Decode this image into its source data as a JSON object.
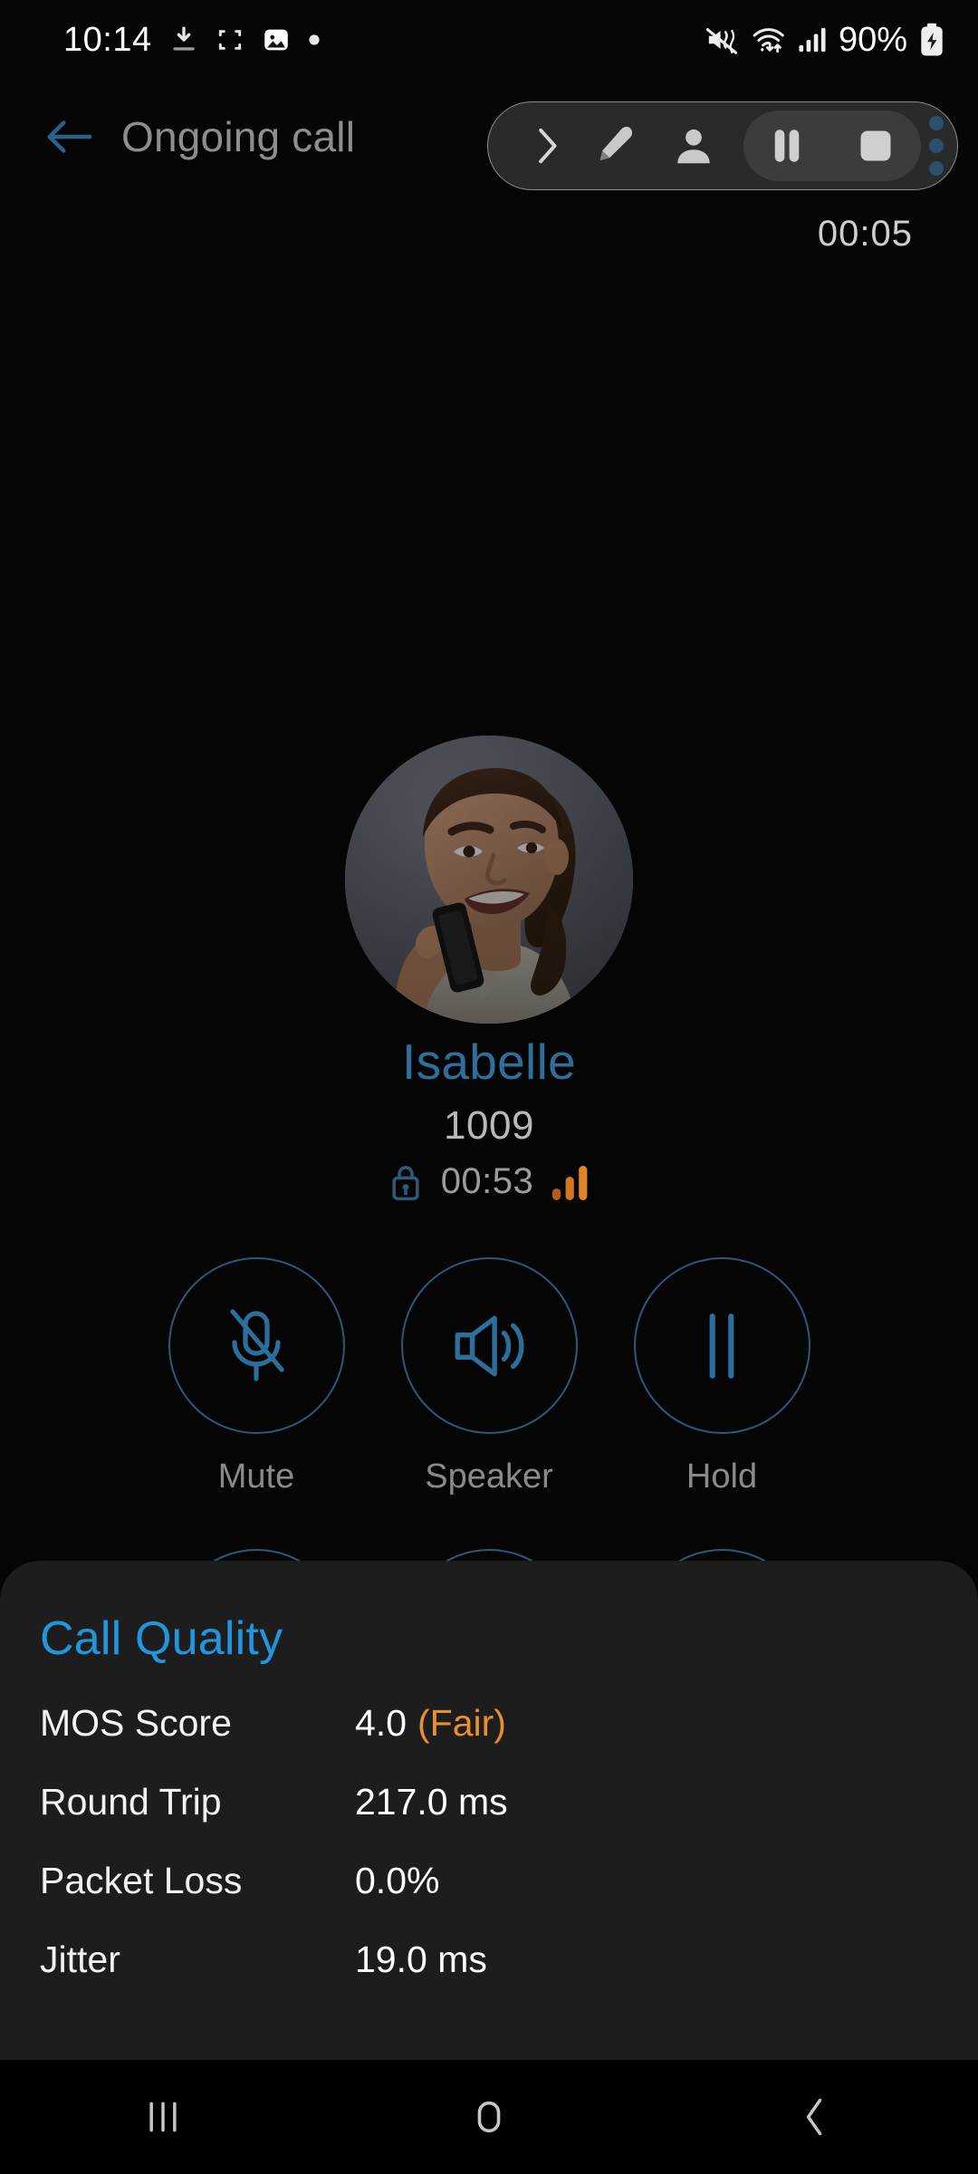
{
  "statusbar": {
    "time": "10:14",
    "battery_percent": "90%",
    "icons": [
      "download-icon",
      "screenshot-frame-icon",
      "image-icon",
      "dot-icon",
      "mute-vibrate-icon",
      "wifi-icon",
      "cellular-signal-icon",
      "battery-charging-icon"
    ]
  },
  "header": {
    "back_icon": "back-arrow-icon",
    "title": "Ongoing call"
  },
  "recorder": {
    "chevron_icon": "chevron-right-icon",
    "pen_icon": "pen-icon",
    "person_icon": "person-icon",
    "pause_icon": "pause-icon",
    "stop_icon": "stop-icon",
    "more_icon": "more-dots-icon",
    "timer": "00:05"
  },
  "call": {
    "avatar_name": "avatar",
    "contact_name": "Isabelle",
    "contact_number": "1009",
    "lock_icon": "lock-icon",
    "duration": "00:53",
    "signal_icon": "signal-bars-icon"
  },
  "controls": {
    "row1": [
      {
        "label": "Mute",
        "icon": "microphone-muted-icon"
      },
      {
        "label": "Speaker",
        "icon": "speaker-icon"
      },
      {
        "label": "Hold",
        "icon": "pause-icon"
      }
    ],
    "row2": [
      {
        "label": "",
        "icon": "hidden-control-icon"
      },
      {
        "label": "",
        "icon": "hidden-control-icon"
      },
      {
        "label": "",
        "icon": "hidden-control-icon"
      }
    ]
  },
  "quality": {
    "title": "Call Quality",
    "rows": [
      {
        "label": "MOS Score",
        "value": "4.0",
        "rating": "(Fair)"
      },
      {
        "label": "Round Trip",
        "value": "217.0 ms",
        "rating": ""
      },
      {
        "label": "Packet Loss",
        "value": "0.0%",
        "rating": ""
      },
      {
        "label": "Jitter",
        "value": "19.0 ms",
        "rating": ""
      }
    ]
  },
  "navbar": {
    "recents_icon": "recents-icon",
    "home_icon": "home-icon",
    "back_icon": "nav-back-icon"
  },
  "colors": {
    "accent_blue": "#2196dd",
    "name_blue": "#2f6f9e",
    "outline_blue": "#285a7d",
    "orange": "#e8912c",
    "panel_bg": "#1d1d1d",
    "screen_bg": "#050505"
  }
}
